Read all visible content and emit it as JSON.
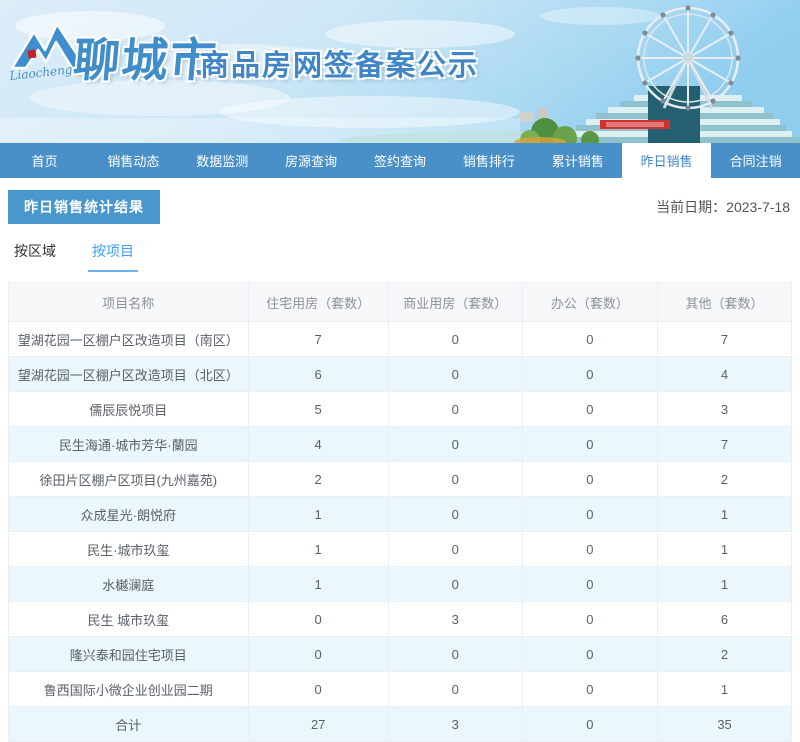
{
  "header": {
    "logo": {
      "script_text": "Liaocheng"
    },
    "city_name": "聊城市",
    "site_title": "商品房网签备案公示"
  },
  "nav": {
    "items": [
      {
        "label": "首页",
        "active": false
      },
      {
        "label": "销售动态",
        "active": false
      },
      {
        "label": "数据监测",
        "active": false
      },
      {
        "label": "房源查询",
        "active": false
      },
      {
        "label": "签约查询",
        "active": false
      },
      {
        "label": "销售排行",
        "active": false
      },
      {
        "label": "累计销售",
        "active": false
      },
      {
        "label": "昨日销售",
        "active": true
      },
      {
        "label": "合同注销",
        "active": false
      }
    ]
  },
  "content": {
    "section_title": "昨日销售统计结果",
    "current_date_label": "当前日期：",
    "current_date_value": "2023-7-18",
    "tabs": [
      {
        "label": "按区域",
        "active": false
      },
      {
        "label": "按项目",
        "active": true
      }
    ]
  },
  "table": {
    "columns": [
      "项目名称",
      "住宅用房（套数）",
      "商业用房（套数）",
      "办公（套数）",
      "其他（套数）"
    ],
    "rows": [
      {
        "name": "望湖花园一区棚户区改造项目（南区）",
        "values": [
          7,
          0,
          0,
          7
        ]
      },
      {
        "name": "望湖花园一区棚户区改造项目（北区）",
        "values": [
          6,
          0,
          0,
          4
        ]
      },
      {
        "name": "儒辰辰悦项目",
        "values": [
          5,
          0,
          0,
          3
        ]
      },
      {
        "name": "民生海通·城市芳华·蘭园",
        "values": [
          4,
          0,
          0,
          7
        ]
      },
      {
        "name": "徐田片区棚户区项目(九州嘉苑)",
        "values": [
          2,
          0,
          0,
          2
        ]
      },
      {
        "name": "众成星光·朗悦府",
        "values": [
          1,
          0,
          0,
          1
        ]
      },
      {
        "name": "民生·城市玖玺",
        "values": [
          1,
          0,
          0,
          1
        ]
      },
      {
        "name": "水樾澜庭",
        "values": [
          1,
          0,
          0,
          1
        ]
      },
      {
        "name": "民生 城市玖玺",
        "values": [
          0,
          3,
          0,
          6
        ]
      },
      {
        "name": "隆兴泰和园住宅项目",
        "values": [
          0,
          0,
          0,
          2
        ]
      },
      {
        "name": "鲁西国际小微企业创业园二期",
        "values": [
          0,
          0,
          0,
          1
        ]
      },
      {
        "name": "合计",
        "values": [
          27,
          3,
          0,
          35
        ],
        "is_total": true
      }
    ]
  },
  "colors": {
    "nav_bg": "#4a90c8",
    "nav_active_text": "#3e86c8",
    "section_badge_bg": "#4a97ce",
    "tab_active": "#409eff",
    "row_alt_bg": "#ebf6fd",
    "table_header_bg": "#f6f8fa",
    "title_blue": "#3e86c8"
  }
}
